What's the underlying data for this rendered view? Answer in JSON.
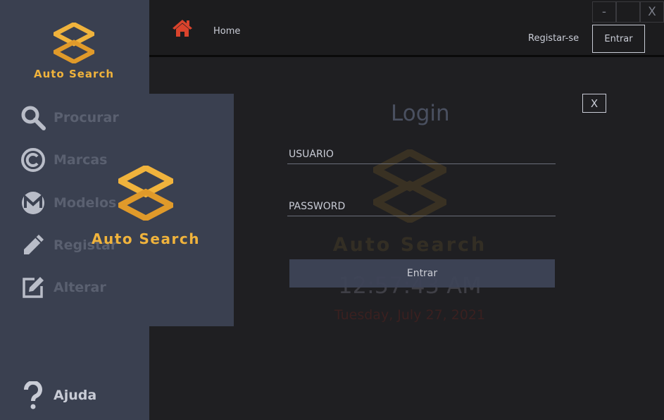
{
  "app": {
    "name": "Auto Search"
  },
  "sidebar": {
    "brand": "Auto Search",
    "items": [
      {
        "label": "Procurar",
        "icon": "search-icon"
      },
      {
        "label": "Marcas",
        "icon": "copyright-icon"
      },
      {
        "label": "Modelos",
        "icon": "monero-icon"
      },
      {
        "label": "Registar",
        "icon": "pencil-icon"
      },
      {
        "label": "Alterar",
        "icon": "edit-icon"
      }
    ],
    "help": {
      "label": "Ajuda",
      "icon": "question-icon"
    }
  },
  "topbar": {
    "home_label": "Home",
    "register_label": "Registar-se",
    "enter_label": "Entrar",
    "window": {
      "minimize": "-",
      "maximize": "",
      "close": "X"
    }
  },
  "flyout": {
    "brand": "Auto Search"
  },
  "background": {
    "brand": "Auto Search",
    "time": "12:57:43 AM",
    "date": "Tuesday, July 27, 2021"
  },
  "login": {
    "title": "Login",
    "close": "X",
    "username_placeholder": "USUÁRIO",
    "password_placeholder": "PASSWORD",
    "submit_label": "Entrar"
  },
  "colors": {
    "accent": "#f0b33c",
    "sidebar": "#3a4050",
    "background": "#1f1f22",
    "home_icon": "#d9432c"
  }
}
